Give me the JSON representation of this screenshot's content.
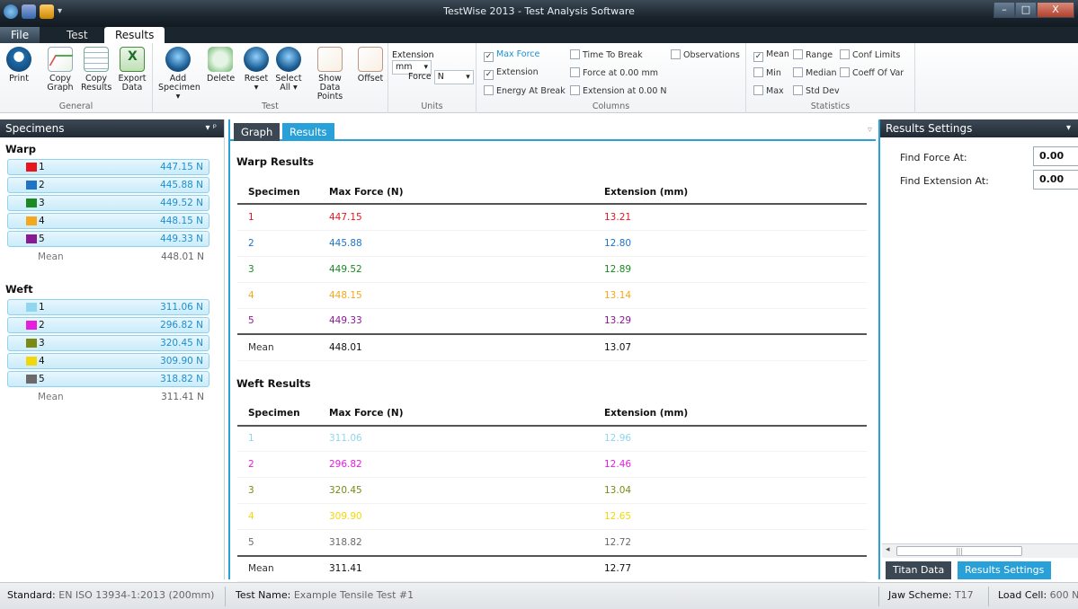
{
  "window": {
    "title": "TestWise 2013 - Test Analysis Software",
    "min": "–",
    "max": "□",
    "close": "X"
  },
  "ribbon_tabs": [
    "File",
    "Test",
    "Results"
  ],
  "ribbon": {
    "general": {
      "label": "General",
      "print": "Print",
      "copy_graph": "Copy Graph",
      "copy_results": "Copy Results",
      "export_data": "Export Data"
    },
    "test": {
      "label": "Test",
      "add_specimen": "Add Specimen ▾",
      "delete": "Delete",
      "reset": "Reset ▾",
      "select_all": "Select All ▾",
      "show_points": "Show Data Points",
      "offset": "Offset"
    },
    "units": {
      "label": "Units",
      "extension_label": "Extension",
      "extension_value": "mm",
      "force_label": "Force",
      "force_value": "N"
    },
    "columns": {
      "label": "Columns",
      "max_force": "Max Force",
      "extension": "Extension",
      "energy_at_break": "Energy At Break",
      "time_to_break": "Time To Break",
      "force_at": "Force at 0.00 mm",
      "extension_at": "Extension at 0.00 N",
      "observations": "Observations"
    },
    "statistics": {
      "label": "Statistics",
      "mean": "Mean",
      "min": "Min",
      "max": "Max",
      "range": "Range",
      "median": "Median",
      "std_dev": "Std Dev",
      "conf_limits": "Conf Limits",
      "coeff_of_var": "Coeff Of Var"
    }
  },
  "specimens_panel": {
    "title": "Specimens",
    "pin": "▾ ᵖ",
    "warp": {
      "title": "Warp",
      "items": [
        {
          "num": "1",
          "value": "447.15 N",
          "color": "#e8161c"
        },
        {
          "num": "2",
          "value": "445.88 N",
          "color": "#1f74c6"
        },
        {
          "num": "3",
          "value": "449.52 N",
          "color": "#1a8a22"
        },
        {
          "num": "4",
          "value": "448.15 N",
          "color": "#f4a81c"
        },
        {
          "num": "5",
          "value": "449.33 N",
          "color": "#8a1a94"
        }
      ],
      "mean_label": "Mean",
      "mean_value": "448.01 N"
    },
    "weft": {
      "title": "Weft",
      "items": [
        {
          "num": "1",
          "value": "311.06 N",
          "color": "#8fd6f0"
        },
        {
          "num": "2",
          "value": "296.82 N",
          "color": "#e61ee0"
        },
        {
          "num": "3",
          "value": "320.45 N",
          "color": "#7a8a12"
        },
        {
          "num": "4",
          "value": "309.90 N",
          "color": "#f2d80a"
        },
        {
          "num": "5",
          "value": "318.82 N",
          "color": "#6a6a6a"
        }
      ],
      "mean_label": "Mean",
      "mean_value": "311.41 N"
    }
  },
  "center": {
    "tabs": [
      "Graph",
      "Results"
    ],
    "warp_title": "Warp Results",
    "weft_title": "Weft Results",
    "headers": [
      "Specimen",
      "Max Force (N)",
      "Extension (mm)"
    ],
    "warp_rows": [
      {
        "spec": "1",
        "force": "447.15",
        "ext": "13.21",
        "color": "#e8161c"
      },
      {
        "spec": "2",
        "force": "445.88",
        "ext": "12.80",
        "color": "#1f74c6"
      },
      {
        "spec": "3",
        "force": "449.52",
        "ext": "12.89",
        "color": "#1a8a22"
      },
      {
        "spec": "4",
        "force": "448.15",
        "ext": "13.14",
        "color": "#f4a81c"
      },
      {
        "spec": "5",
        "force": "449.33",
        "ext": "13.29",
        "color": "#8a1a94"
      }
    ],
    "warp_mean": {
      "spec": "Mean",
      "force": "448.01",
      "ext": "13.07"
    },
    "weft_rows": [
      {
        "spec": "1",
        "force": "311.06",
        "ext": "12.96",
        "color": "#8fd6f0"
      },
      {
        "spec": "2",
        "force": "296.82",
        "ext": "12.46",
        "color": "#e61ee0"
      },
      {
        "spec": "3",
        "force": "320.45",
        "ext": "13.04",
        "color": "#7a8a12"
      },
      {
        "spec": "4",
        "force": "309.90",
        "ext": "12.65",
        "color": "#f2d80a"
      },
      {
        "spec": "5",
        "force": "318.82",
        "ext": "12.72",
        "color": "#6a6a6a"
      }
    ],
    "weft_mean": {
      "spec": "Mean",
      "force": "311.41",
      "ext": "12.77"
    }
  },
  "settings_panel": {
    "title": "Results Settings",
    "find_force_label": "Find Force At:",
    "find_force_value": "0.00",
    "find_ext_label": "Find Extension At:",
    "find_ext_value": "0.00",
    "tabs": [
      "Titan Data",
      "Results Settings"
    ]
  },
  "status": {
    "standard_label": "Standard:",
    "standard_value": "EN ISO 13934-1:2013 (200mm)",
    "test_name_label": "Test Name:",
    "test_name_value": "Example Tensile Test #1",
    "jaw_label": "Jaw Scheme:",
    "jaw_value": "T17",
    "load_label": "Load Cell:",
    "load_value": "600 N"
  }
}
